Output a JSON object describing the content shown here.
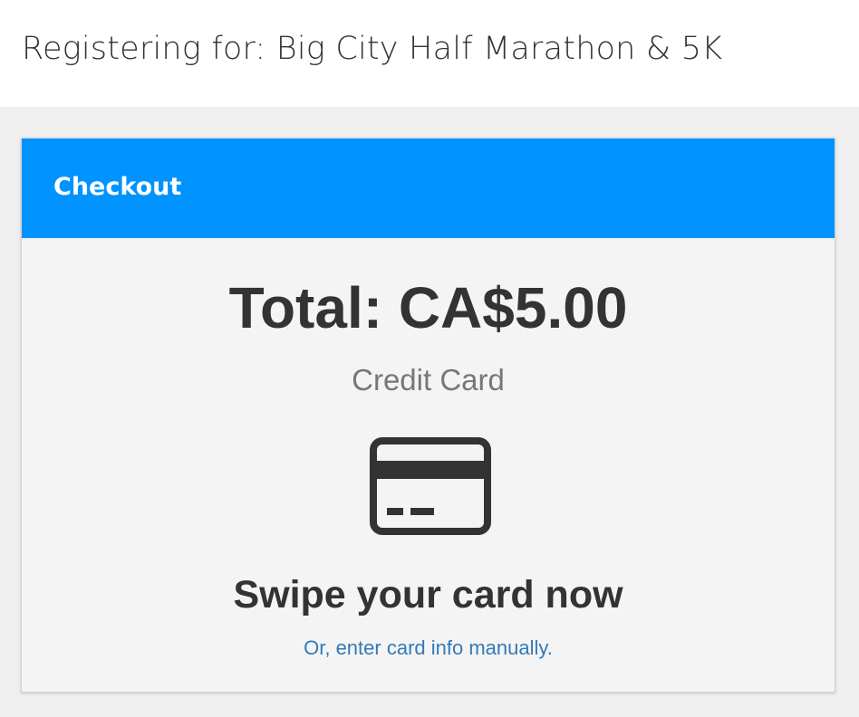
{
  "header": {
    "title": "Registering for: Big City Half Marathon & 5K"
  },
  "checkout": {
    "title": "Checkout",
    "total": "Total: CA$5.00",
    "payment_method": "Credit Card",
    "icon": "credit-card-icon",
    "instruction": "Swipe your card now",
    "manual_link": "Or, enter card info manually."
  },
  "colors": {
    "header_blue": "#0093ff",
    "link_blue": "#337ab7",
    "text_dark": "#333333",
    "text_gray": "#777777"
  }
}
